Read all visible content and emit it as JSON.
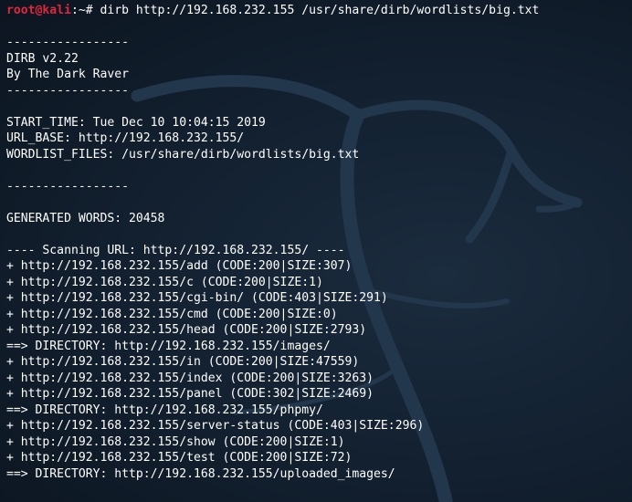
{
  "prompt": {
    "user_host": "root@kali",
    "path": ":~#",
    "command": " dirb http://192.168.232.155 /usr/share/dirb/wordlists/big.txt"
  },
  "output": {
    "line_01": "",
    "line_02": "-----------------",
    "line_03": "DIRB v2.22",
    "line_04": "By The Dark Raver",
    "line_05": "-----------------",
    "line_06": "",
    "line_07": "START_TIME: Tue Dec 10 10:04:15 2019",
    "line_08": "URL_BASE: http://192.168.232.155/",
    "line_09": "WORDLIST_FILES: /usr/share/dirb/wordlists/big.txt",
    "line_10": "",
    "line_11": "-----------------",
    "line_12": "",
    "line_13": "GENERATED WORDS: 20458",
    "line_14": "",
    "line_15": "---- Scanning URL: http://192.168.232.155/ ----",
    "line_16": "+ http://192.168.232.155/add (CODE:200|SIZE:307)",
    "line_17": "+ http://192.168.232.155/c (CODE:200|SIZE:1)",
    "line_18": "+ http://192.168.232.155/cgi-bin/ (CODE:403|SIZE:291)",
    "line_19": "+ http://192.168.232.155/cmd (CODE:200|SIZE:0)",
    "line_20": "+ http://192.168.232.155/head (CODE:200|SIZE:2793)",
    "line_21": "==> DIRECTORY: http://192.168.232.155/images/",
    "line_22": "+ http://192.168.232.155/in (CODE:200|SIZE:47559)",
    "line_23": "+ http://192.168.232.155/index (CODE:200|SIZE:3263)",
    "line_24": "+ http://192.168.232.155/panel (CODE:302|SIZE:2469)",
    "line_25": "==> DIRECTORY: http://192.168.232.155/phpmy/",
    "line_26": "+ http://192.168.232.155/server-status (CODE:403|SIZE:296)",
    "line_27": "+ http://192.168.232.155/show (CODE:200|SIZE:1)",
    "line_28": "+ http://192.168.232.155/test (CODE:200|SIZE:72)",
    "line_29": "==> DIRECTORY: http://192.168.232.155/uploaded_images/"
  },
  "colors": {
    "prompt_user": "#e0263c",
    "text": "#ffffff",
    "background": "#132131"
  }
}
